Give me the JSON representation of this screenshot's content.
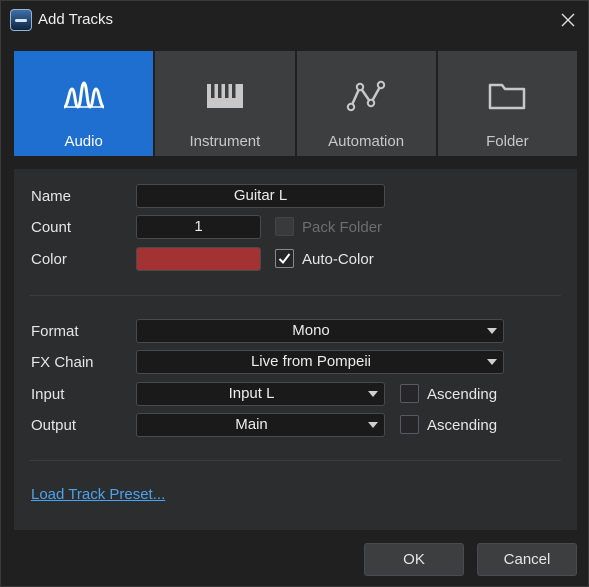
{
  "window": {
    "title": "Add Tracks"
  },
  "tabs": [
    {
      "label": "Audio",
      "icon": "waveform-icon",
      "active": true
    },
    {
      "label": "Instrument",
      "icon": "piano-keys-icon",
      "active": false
    },
    {
      "label": "Automation",
      "icon": "automation-curve-icon",
      "active": false
    },
    {
      "label": "Folder",
      "icon": "folder-icon",
      "active": false
    }
  ],
  "form": {
    "name_label": "Name",
    "name_value": "Guitar L",
    "count_label": "Count",
    "count_value": "1",
    "pack_folder_label": "Pack Folder",
    "color_label": "Color",
    "color_value": "#a33333",
    "auto_color_label": "Auto-Color",
    "format_label": "Format",
    "format_value": "Mono",
    "fx_chain_label": "FX Chain",
    "fx_chain_value": "Live from Pompeii",
    "input_label": "Input",
    "input_value": "Input L",
    "input_ascending_label": "Ascending",
    "output_label": "Output",
    "output_value": "Main",
    "output_ascending_label": "Ascending"
  },
  "load_preset_link": "Load Track Preset...",
  "buttons": {
    "ok": "OK",
    "cancel": "Cancel"
  },
  "colors": {
    "accent": "#1e6fd0",
    "link": "#4aa3f0",
    "track_color": "#a33333"
  }
}
